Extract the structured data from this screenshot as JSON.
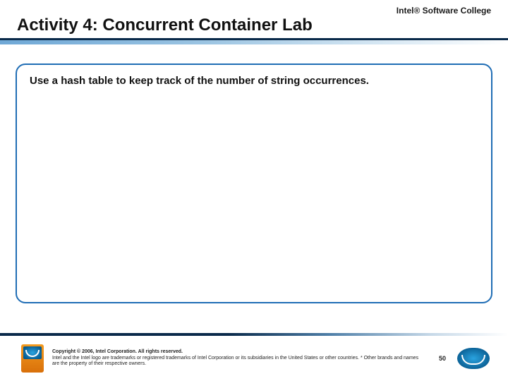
{
  "header": {
    "top_right_label": "Intel® Software College",
    "title": "Activity 4: Concurrent Container Lab"
  },
  "content": {
    "body_text": "Use a hash table to keep track of the number of string occurrences."
  },
  "footer": {
    "copyright_line": "Copyright © 2006, Intel Corporation. All rights reserved.",
    "legal_line": "Intel and the Intel logo are trademarks or registered trademarks of Intel Corporation or its subsidiaries in the United States or other countries. * Other brands and names are the property of their respective owners.",
    "page_number": "50"
  },
  "icons": {
    "badge": "intel-software-badge",
    "logo": "intel-logo"
  }
}
